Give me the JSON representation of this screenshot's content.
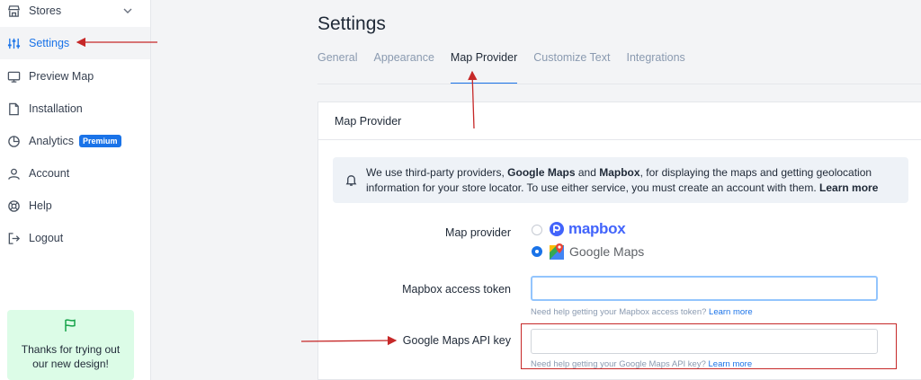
{
  "sidebar": {
    "items": [
      {
        "label": "Stores",
        "icon": "store-icon"
      },
      {
        "label": "Settings",
        "icon": "sliders-icon"
      },
      {
        "label": "Preview Map",
        "icon": "monitor-icon"
      },
      {
        "label": "Installation",
        "icon": "file-icon"
      },
      {
        "label": "Analytics",
        "icon": "chart-pie-icon",
        "badge": "Premium"
      },
      {
        "label": "Account",
        "icon": "user-icon"
      },
      {
        "label": "Help",
        "icon": "lifebuoy-icon"
      },
      {
        "label": "Logout",
        "icon": "logout-icon"
      }
    ],
    "promo": {
      "line1": "Thanks for trying out",
      "line2": "our new design!"
    }
  },
  "header": {
    "title": "Settings"
  },
  "tabs": [
    "General",
    "Appearance",
    "Map Provider",
    "Customize Text",
    "Integrations"
  ],
  "card": {
    "title": "Map Provider",
    "notice": {
      "t1": "We use third-party providers, ",
      "b1": "Google Maps",
      "t2": " and ",
      "b2": "Mapbox",
      "t3": ", for displaying the maps and getting geolocation information for your store locator. To use either service, you must create an account with them. ",
      "link": "Learn more"
    },
    "map_provider": {
      "label": "Map provider",
      "options": [
        "mapbox",
        "Google Maps"
      ],
      "selected": "Google Maps"
    },
    "mapbox_token": {
      "label": "Mapbox access token",
      "value": "",
      "help": "Need help getting your Mapbox access token?",
      "link": "Learn more"
    },
    "google_key": {
      "label": "Google Maps API key",
      "value": "",
      "help": "Need help getting your Google Maps API key?",
      "link": "Learn more"
    }
  },
  "colors": {
    "accent": "#1a73e8",
    "annotation": "#c62828",
    "promo_bg": "#dcfce7"
  }
}
